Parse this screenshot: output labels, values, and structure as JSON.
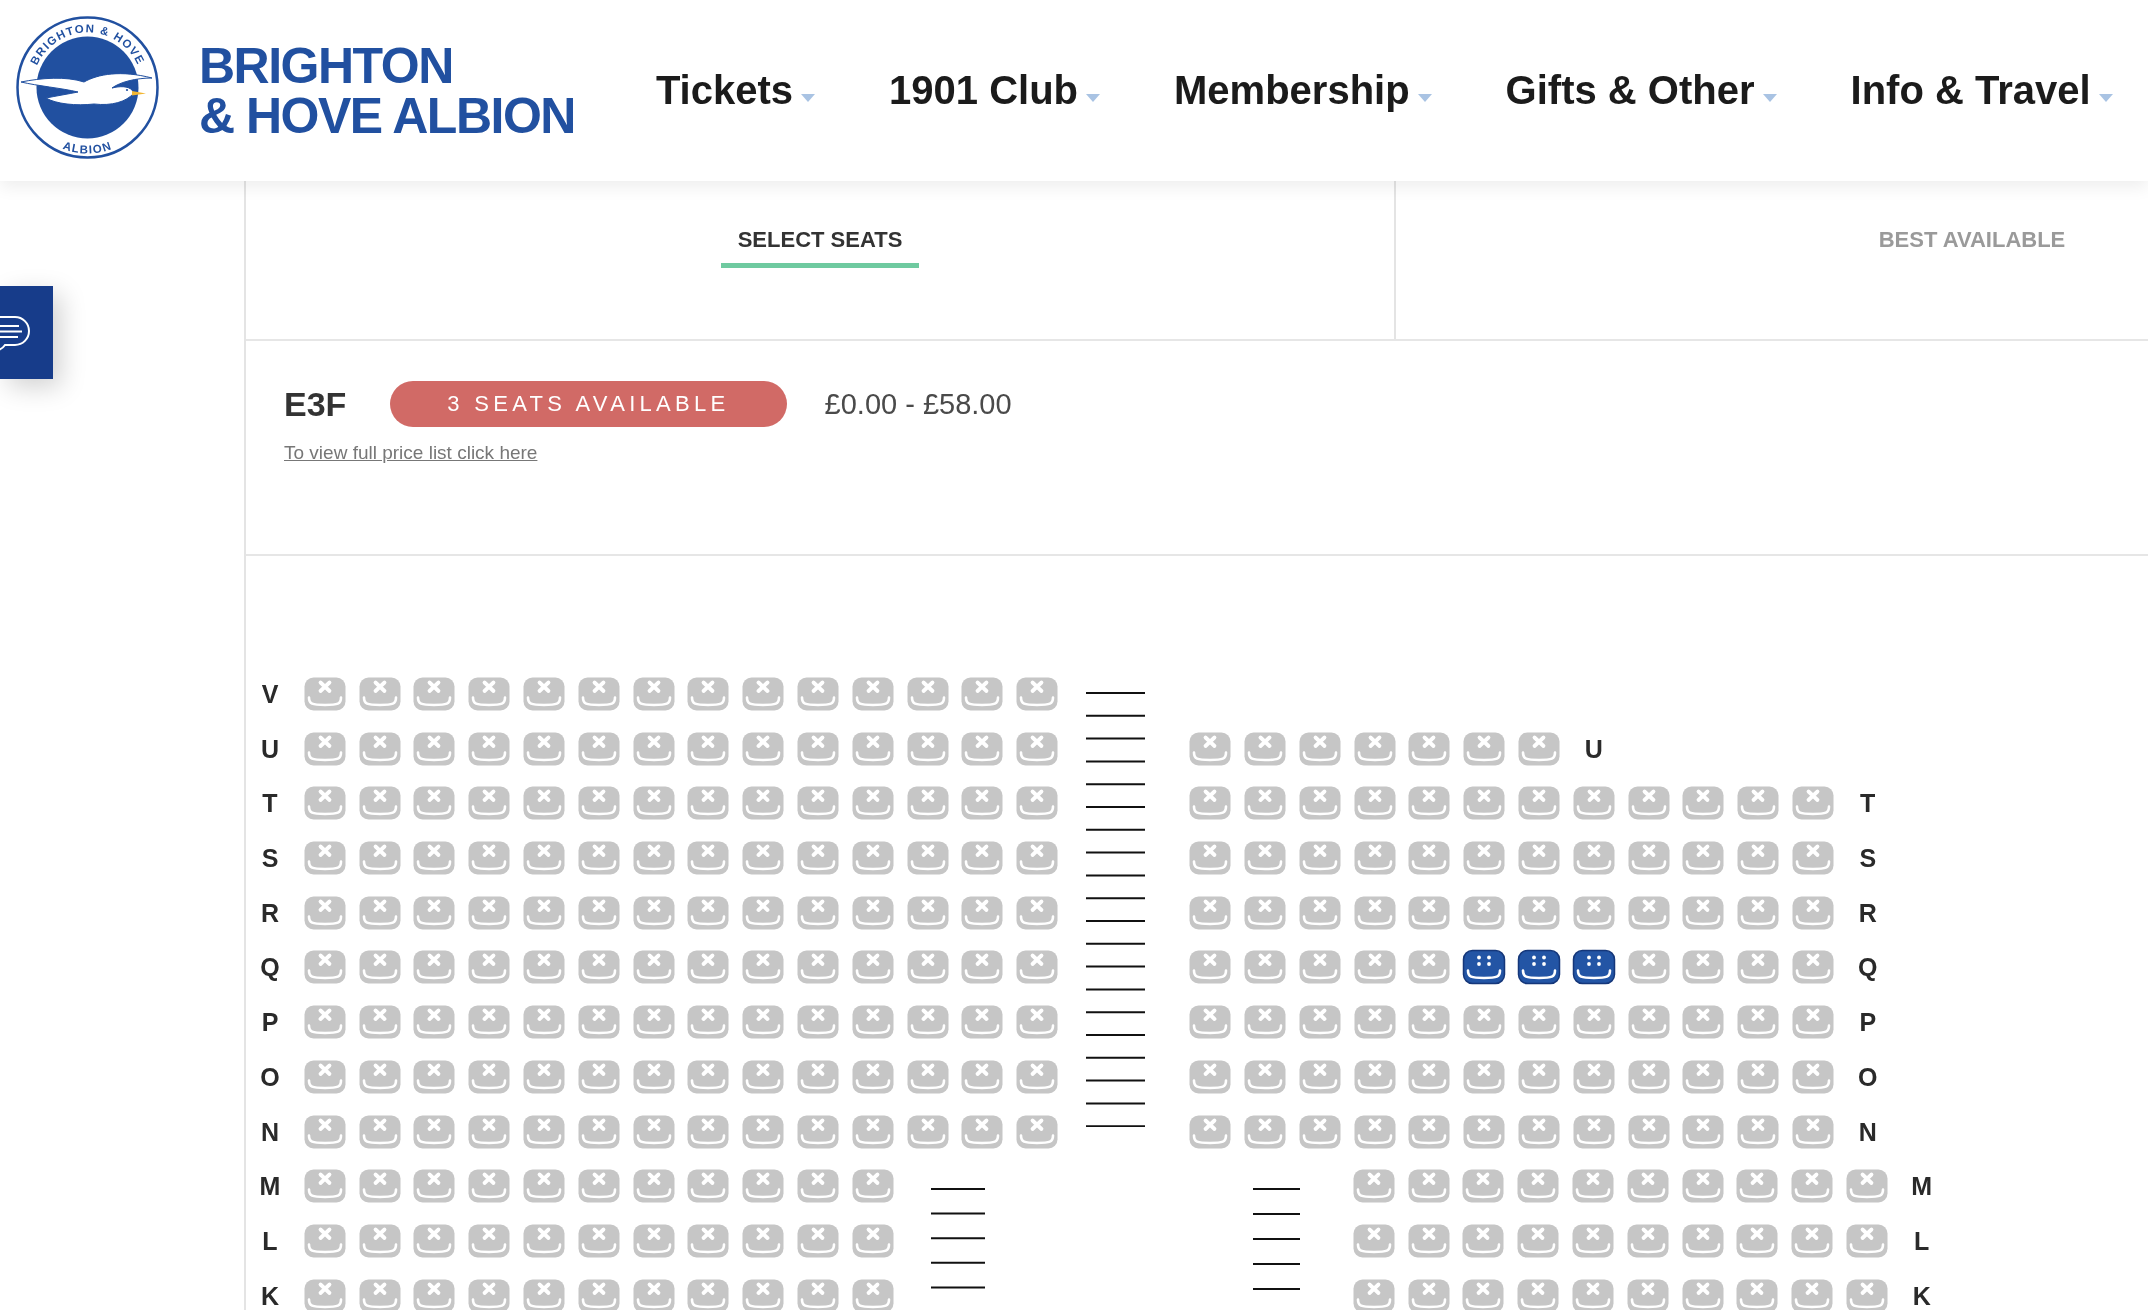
{
  "header": {
    "crest": {
      "top_text": "BRIGHTON & HOVE",
      "bottom_text": "ALBION"
    },
    "wordmark": [
      "BRIGHTON",
      "& HOVE ALBION"
    ],
    "nav": [
      "Tickets",
      "1901 Club",
      "Membership",
      "Gifts & Other",
      "Info & Travel"
    ]
  },
  "tabs": [
    {
      "label": "SELECT SEATS",
      "selected": true
    },
    {
      "label": "BEST AVAILABLE",
      "selected": false
    }
  ],
  "section": {
    "name": "E3F",
    "availability": "3 SEATS AVAILABLE",
    "price_range": "£0.00 - £58.00",
    "price_list_link": "To view full price list click here"
  },
  "seat_map": {
    "tiers": [
      {
        "blocks": [
          {
            "kind": "left",
            "rows": [
              {
                "label": "V",
                "seats": [
                  {
                    "available": false
                  },
                  {
                    "available": false
                  },
                  {
                    "available": false
                  },
                  {
                    "available": false
                  },
                  {
                    "available": false
                  },
                  {
                    "available": false
                  },
                  {
                    "available": false
                  },
                  {
                    "available": false
                  },
                  {
                    "available": false
                  },
                  {
                    "available": false
                  },
                  {
                    "available": false
                  },
                  {
                    "available": false
                  },
                  {
                    "available": false
                  },
                  {
                    "available": false
                  }
                ]
              },
              {
                "label": "U",
                "seats": [
                  {
                    "available": false
                  },
                  {
                    "available": false
                  },
                  {
                    "available": false
                  },
                  {
                    "available": false
                  },
                  {
                    "available": false
                  },
                  {
                    "available": false
                  },
                  {
                    "available": false
                  },
                  {
                    "available": false
                  },
                  {
                    "available": false
                  },
                  {
                    "available": false
                  },
                  {
                    "available": false
                  },
                  {
                    "available": false
                  },
                  {
                    "available": false
                  },
                  {
                    "available": false
                  }
                ]
              },
              {
                "label": "T",
                "seats": [
                  {
                    "available": false
                  },
                  {
                    "available": false
                  },
                  {
                    "available": false
                  },
                  {
                    "available": false
                  },
                  {
                    "available": false
                  },
                  {
                    "available": false
                  },
                  {
                    "available": false
                  },
                  {
                    "available": false
                  },
                  {
                    "available": false
                  },
                  {
                    "available": false
                  },
                  {
                    "available": false
                  },
                  {
                    "available": false
                  },
                  {
                    "available": false
                  },
                  {
                    "available": false
                  }
                ]
              },
              {
                "label": "S",
                "seats": [
                  {
                    "available": false
                  },
                  {
                    "available": false
                  },
                  {
                    "available": false
                  },
                  {
                    "available": false
                  },
                  {
                    "available": false
                  },
                  {
                    "available": false
                  },
                  {
                    "available": false
                  },
                  {
                    "available": false
                  },
                  {
                    "available": false
                  },
                  {
                    "available": false
                  },
                  {
                    "available": false
                  },
                  {
                    "available": false
                  },
                  {
                    "available": false
                  },
                  {
                    "available": false
                  }
                ]
              },
              {
                "label": "R",
                "seats": [
                  {
                    "available": false
                  },
                  {
                    "available": false
                  },
                  {
                    "available": false
                  },
                  {
                    "available": false
                  },
                  {
                    "available": false
                  },
                  {
                    "available": false
                  },
                  {
                    "available": false
                  },
                  {
                    "available": false
                  },
                  {
                    "available": false
                  },
                  {
                    "available": false
                  },
                  {
                    "available": false
                  },
                  {
                    "available": false
                  },
                  {
                    "available": false
                  },
                  {
                    "available": false
                  }
                ]
              },
              {
                "label": "Q",
                "seats": [
                  {
                    "available": false
                  },
                  {
                    "available": false
                  },
                  {
                    "available": false
                  },
                  {
                    "available": false
                  },
                  {
                    "available": false
                  },
                  {
                    "available": false
                  },
                  {
                    "available": false
                  },
                  {
                    "available": false
                  },
                  {
                    "available": false
                  },
                  {
                    "available": false
                  },
                  {
                    "available": false
                  },
                  {
                    "available": false
                  },
                  {
                    "available": false
                  },
                  {
                    "available": false
                  }
                ]
              },
              {
                "label": "P",
                "seats": [
                  {
                    "available": false
                  },
                  {
                    "available": false
                  },
                  {
                    "available": false
                  },
                  {
                    "available": false
                  },
                  {
                    "available": false
                  },
                  {
                    "available": false
                  },
                  {
                    "available": false
                  },
                  {
                    "available": false
                  },
                  {
                    "available": false
                  },
                  {
                    "available": false
                  },
                  {
                    "available": false
                  },
                  {
                    "available": false
                  },
                  {
                    "available": false
                  },
                  {
                    "available": false
                  }
                ]
              },
              {
                "label": "O",
                "seats": [
                  {
                    "available": false
                  },
                  {
                    "available": false
                  },
                  {
                    "available": false
                  },
                  {
                    "available": false
                  },
                  {
                    "available": false
                  },
                  {
                    "available": false
                  },
                  {
                    "available": false
                  },
                  {
                    "available": false
                  },
                  {
                    "available": false
                  },
                  {
                    "available": false
                  },
                  {
                    "available": false
                  },
                  {
                    "available": false
                  },
                  {
                    "available": false
                  },
                  {
                    "available": false
                  }
                ]
              },
              {
                "label": "N",
                "seats": [
                  {
                    "available": false
                  },
                  {
                    "available": false
                  },
                  {
                    "available": false
                  },
                  {
                    "available": false
                  },
                  {
                    "available": false
                  },
                  {
                    "available": false
                  },
                  {
                    "available": false
                  },
                  {
                    "available": false
                  },
                  {
                    "available": false
                  },
                  {
                    "available": false
                  },
                  {
                    "available": false
                  },
                  {
                    "available": false
                  },
                  {
                    "available": false
                  },
                  {
                    "available": false
                  }
                ]
              }
            ]
          },
          {
            "kind": "right",
            "rows": [
              {
                "label": "U",
                "seats": [
                  {
                    "available": false
                  },
                  {
                    "available": false
                  },
                  {
                    "available": false
                  },
                  {
                    "available": false
                  },
                  {
                    "available": false
                  },
                  {
                    "available": false
                  },
                  {
                    "available": false
                  }
                ]
              },
              {
                "label": "T",
                "seats": [
                  {
                    "available": false
                  },
                  {
                    "available": false
                  },
                  {
                    "available": false
                  },
                  {
                    "available": false
                  },
                  {
                    "available": false
                  },
                  {
                    "available": false
                  },
                  {
                    "available": false
                  },
                  {
                    "available": false
                  },
                  {
                    "available": false
                  },
                  {
                    "available": false
                  },
                  {
                    "available": false
                  },
                  {
                    "available": false
                  }
                ]
              },
              {
                "label": "S",
                "seats": [
                  {
                    "available": false
                  },
                  {
                    "available": false
                  },
                  {
                    "available": false
                  },
                  {
                    "available": false
                  },
                  {
                    "available": false
                  },
                  {
                    "available": false
                  },
                  {
                    "available": false
                  },
                  {
                    "available": false
                  },
                  {
                    "available": false
                  },
                  {
                    "available": false
                  },
                  {
                    "available": false
                  },
                  {
                    "available": false
                  }
                ]
              },
              {
                "label": "R",
                "seats": [
                  {
                    "available": false
                  },
                  {
                    "available": false
                  },
                  {
                    "available": false
                  },
                  {
                    "available": false
                  },
                  {
                    "available": false
                  },
                  {
                    "available": false
                  },
                  {
                    "available": false
                  },
                  {
                    "available": false
                  },
                  {
                    "available": false
                  },
                  {
                    "available": false
                  },
                  {
                    "available": false
                  },
                  {
                    "available": false
                  }
                ]
              },
              {
                "label": "Q",
                "seats": [
                  {
                    "available": false
                  },
                  {
                    "available": false
                  },
                  {
                    "available": false
                  },
                  {
                    "available": false
                  },
                  {
                    "available": false
                  },
                  {
                    "available": true
                  },
                  {
                    "available": true
                  },
                  {
                    "available": true
                  },
                  {
                    "available": false
                  },
                  {
                    "available": false
                  },
                  {
                    "available": false
                  },
                  {
                    "available": false
                  }
                ]
              },
              {
                "label": "P",
                "seats": [
                  {
                    "available": false
                  },
                  {
                    "available": false
                  },
                  {
                    "available": false
                  },
                  {
                    "available": false
                  },
                  {
                    "available": false
                  },
                  {
                    "available": false
                  },
                  {
                    "available": false
                  },
                  {
                    "available": false
                  },
                  {
                    "available": false
                  },
                  {
                    "available": false
                  },
                  {
                    "available": false
                  },
                  {
                    "available": false
                  }
                ]
              },
              {
                "label": "O",
                "seats": [
                  {
                    "available": false
                  },
                  {
                    "available": false
                  },
                  {
                    "available": false
                  },
                  {
                    "available": false
                  },
                  {
                    "available": false
                  },
                  {
                    "available": false
                  },
                  {
                    "available": false
                  },
                  {
                    "available": false
                  },
                  {
                    "available": false
                  },
                  {
                    "available": false
                  },
                  {
                    "available": false
                  },
                  {
                    "available": false
                  }
                ]
              },
              {
                "label": "N",
                "seats": [
                  {
                    "available": false
                  },
                  {
                    "available": false
                  },
                  {
                    "available": false
                  },
                  {
                    "available": false
                  },
                  {
                    "available": false
                  },
                  {
                    "available": false
                  },
                  {
                    "available": false
                  },
                  {
                    "available": false
                  },
                  {
                    "available": false
                  },
                  {
                    "available": false
                  },
                  {
                    "available": false
                  },
                  {
                    "available": false
                  }
                ]
              }
            ]
          }
        ]
      },
      {
        "blocks": [
          {
            "kind": "left",
            "rows": [
              {
                "label": "M",
                "seats": [
                  {
                    "available": false
                  },
                  {
                    "available": false
                  },
                  {
                    "available": false
                  },
                  {
                    "available": false
                  },
                  {
                    "available": false
                  },
                  {
                    "available": false
                  },
                  {
                    "available": false
                  },
                  {
                    "available": false
                  },
                  {
                    "available": false
                  },
                  {
                    "available": false
                  },
                  {
                    "available": false
                  }
                ]
              },
              {
                "label": "L",
                "seats": [
                  {
                    "available": false
                  },
                  {
                    "available": false
                  },
                  {
                    "available": false
                  },
                  {
                    "available": false
                  },
                  {
                    "available": false
                  },
                  {
                    "available": false
                  },
                  {
                    "available": false
                  },
                  {
                    "available": false
                  },
                  {
                    "available": false
                  },
                  {
                    "available": false
                  },
                  {
                    "available": false
                  }
                ]
              },
              {
                "label": "K",
                "seats": [
                  {
                    "available": false
                  },
                  {
                    "available": false
                  },
                  {
                    "available": false
                  },
                  {
                    "available": false
                  },
                  {
                    "available": false
                  },
                  {
                    "available": false
                  },
                  {
                    "available": false
                  },
                  {
                    "available": false
                  },
                  {
                    "available": false
                  },
                  {
                    "available": false
                  },
                  {
                    "available": false
                  }
                ]
              }
            ]
          },
          {
            "kind": "right",
            "rows": [
              {
                "label": "M",
                "seats": [
                  {
                    "available": false
                  },
                  {
                    "available": false
                  },
                  {
                    "available": false
                  },
                  {
                    "available": false
                  },
                  {
                    "available": false
                  },
                  {
                    "available": false
                  },
                  {
                    "available": false
                  },
                  {
                    "available": false
                  },
                  {
                    "available": false
                  },
                  {
                    "available": false
                  }
                ]
              },
              {
                "label": "L",
                "seats": [
                  {
                    "available": false
                  },
                  {
                    "available": false
                  },
                  {
                    "available": false
                  },
                  {
                    "available": false
                  },
                  {
                    "available": false
                  },
                  {
                    "available": false
                  },
                  {
                    "available": false
                  },
                  {
                    "available": false
                  },
                  {
                    "available": false
                  },
                  {
                    "available": false
                  }
                ]
              },
              {
                "label": "K",
                "seats": [
                  {
                    "available": false
                  },
                  {
                    "available": false
                  },
                  {
                    "available": false
                  },
                  {
                    "available": false
                  },
                  {
                    "available": false
                  },
                  {
                    "available": false
                  },
                  {
                    "available": false
                  },
                  {
                    "available": false
                  },
                  {
                    "available": false
                  },
                  {
                    "available": false
                  }
                ]
              }
            ]
          }
        ]
      }
    ]
  }
}
